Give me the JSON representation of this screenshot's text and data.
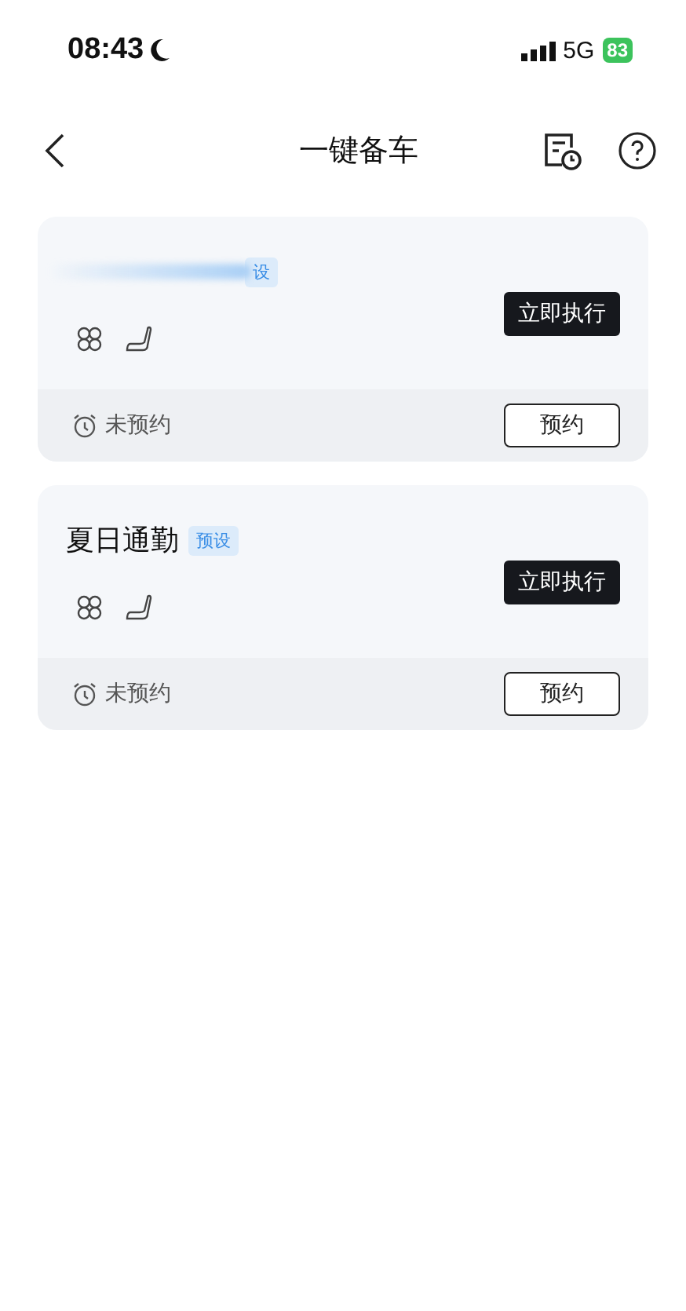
{
  "status_bar": {
    "time": "08:43",
    "network": "5G",
    "battery": "83"
  },
  "nav": {
    "title": "一键备车"
  },
  "cards": [
    {
      "obscured": true,
      "badge": "设",
      "action": "立即执行",
      "schedule_status": "未预约",
      "schedule_button": "预约"
    },
    {
      "title": "夏日通勤",
      "obscured": false,
      "badge": "预设",
      "action": "立即执行",
      "schedule_status": "未预约",
      "schedule_button": "预约"
    }
  ]
}
